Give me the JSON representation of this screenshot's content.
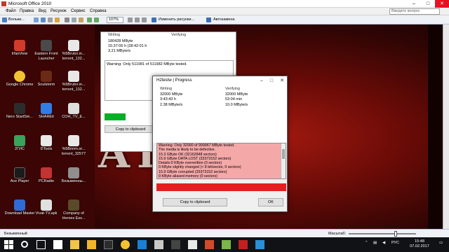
{
  "window": {
    "title": "Microsoft Office 2010",
    "controls": [
      "–",
      "□",
      "✕"
    ]
  },
  "menu": {
    "items": [
      "Файл",
      "Правка",
      "Вид",
      "Рисунок",
      "Сервис",
      "Справка"
    ],
    "help_placeholder": "Введите вопрос"
  },
  "toolbar": {
    "zoom": "107%",
    "reload_label": "Вольки...",
    "resize_label": "Изменить рисунки...",
    "autocorrect_label": "Автозамена"
  },
  "desktop_icons": [
    {
      "label": "IrfanView",
      "icon": "irfanview-icon",
      "color": "#d23b2b"
    },
    {
      "label": "Eastern Front Launcher",
      "icon": "game-launcher-icon",
      "color": "#4a4a4a"
    },
    {
      "label": "%5Brutor.in... torrent_132...",
      "icon": "torrent-file-icon",
      "color": "#e8e8e8"
    },
    {
      "label": "Google Chrome",
      "icon": "chrome-icon",
      "color": "#f2c230"
    },
    {
      "label": "Soulstorm",
      "icon": "soulstorm-icon",
      "color": "#6b2a15"
    },
    {
      "label": "%5Brutor.in... torrent_132...",
      "icon": "torrent-file-icon",
      "color": "#e8e8e8"
    },
    {
      "label": "Nero StartSm...",
      "icon": "nero-icon",
      "color": "#2c2c2c"
    },
    {
      "label": "SHAREit",
      "icon": "shareit-icon",
      "color": "#2f7ee6"
    },
    {
      "label": "COH_TV_E...",
      "icon": "file-icon",
      "color": "#dedede"
    },
    {
      "label": "2ГИС",
      "icon": "2gis-icon",
      "color": "#3aa35c"
    },
    {
      "label": "DTools",
      "icon": "dtools-icon",
      "color": "#e9e9e9"
    },
    {
      "label": "%5Bnnm.or... torrent_32577",
      "icon": "torrent-file-icon",
      "color": "#e8e8e8"
    },
    {
      "label": "Ace Player",
      "icon": "ace-player-icon",
      "color": "#1b1b1b"
    },
    {
      "label": "PCRadio",
      "icon": "pcradio-icon",
      "color": "#c23333"
    },
    {
      "label": "Безымянны...",
      "icon": "image-file-icon",
      "color": "#8f8f8f"
    },
    {
      "label": "Download Master",
      "icon": "download-master-icon",
      "color": "#2e6bd6"
    },
    {
      "label": "Vivat-TV.apk",
      "icon": "apk-file-icon",
      "color": "#e0e0e0"
    },
    {
      "label": "Company of Heroes Ess...",
      "icon": "coh-icon",
      "color": "#5a4a2a"
    }
  ],
  "back_dialog": {
    "col1_header": "Writing",
    "col2_header": "Verifying",
    "col1_values": [
      "180428 MByte",
      "15:37:06 h (28:42:01 h",
      "3.21 MByte/s"
    ],
    "warning": "Warning: Only 511981 of 511982 MByte tested.",
    "copy_label": "Copy to clipboard",
    "progress_color": "#06b025"
  },
  "front_dialog": {
    "title": "H2testw | Progress",
    "col1_header": "Writing",
    "col2_header": "Verifying",
    "col1_values": [
      "32000 MByte",
      "3:43:43 h",
      "2.38 MByte/s"
    ],
    "col2_values": [
      "32000 MByte",
      "53:04 min",
      "10.0 MByte/s"
    ],
    "log_lines": [
      "Warning: Only 32000 of 999967 MByte tested.",
      "The media is likely to be defective.",
      "15.3 GByte OK (32162848 sectors)",
      "15.9 GByte DATA LOST (33373152 sectors)",
      "Details:0 KByte overwritten (0 sectors)",
      "0 KByte slightly changed (< 8 bit/sector, 0 sectors)",
      "15.9 GByte corrupted (33373152 sectors)",
      "0 KByte aliased memory (0 sectors)"
    ],
    "log_color": "#f4a8a8",
    "result_bar_color": "#e32020",
    "copy_label": "Copy to clipboard",
    "ok_label": "OK"
  },
  "background": {
    "word": "AL    AL"
  },
  "statusbar": {
    "left_text": "Безымянный",
    "zoom_label": "Масштаб:"
  },
  "taskbar": {
    "lang": "РУС",
    "time": "15:48",
    "date": "07.02.2017"
  }
}
